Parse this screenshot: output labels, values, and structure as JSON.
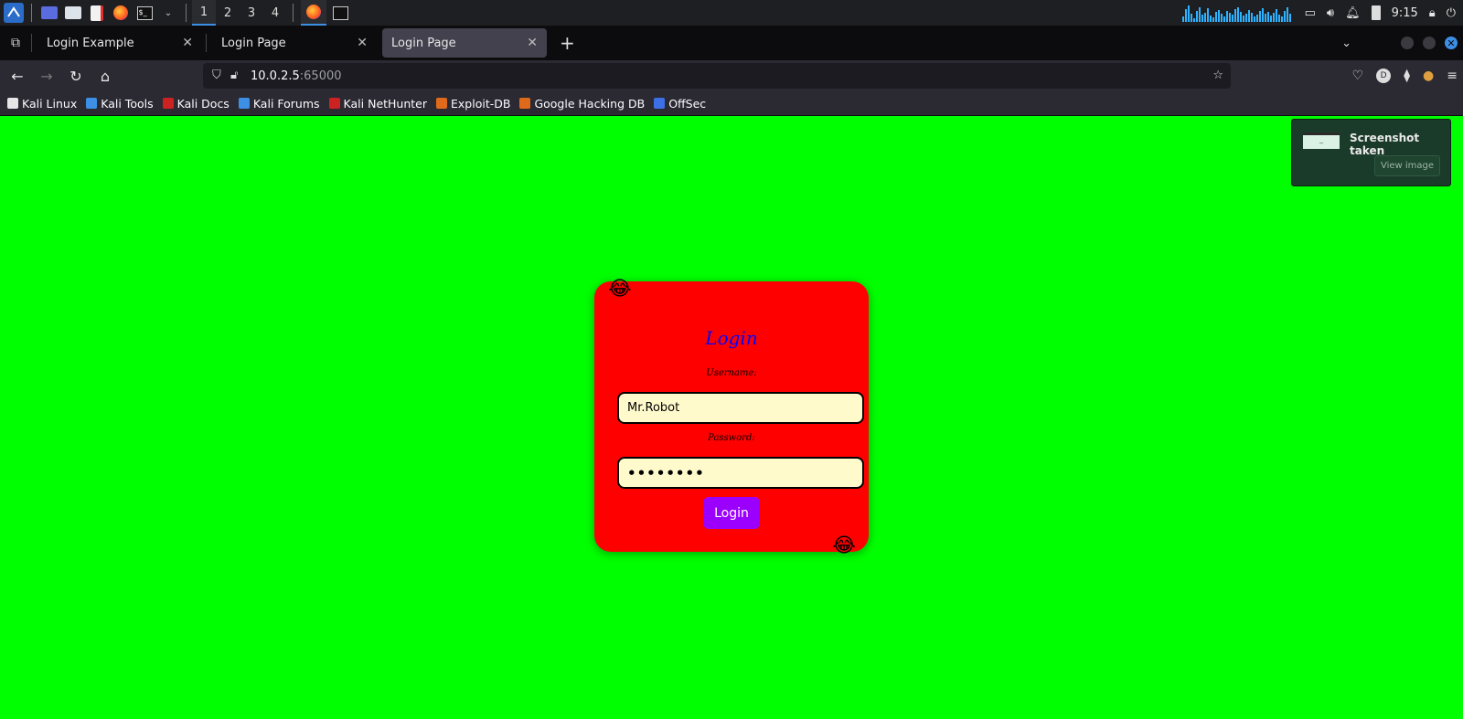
{
  "taskbar": {
    "workspaces": [
      "1",
      "2",
      "3",
      "4"
    ],
    "active_workspace": "1",
    "clock": "9:15"
  },
  "tabs": [
    {
      "label": "Login Example",
      "active": false
    },
    {
      "label": "Login Page",
      "active": false
    },
    {
      "label": "Login Page",
      "active": true
    }
  ],
  "url": {
    "host": "10.0.2.5",
    "port": ":65000"
  },
  "bookmarks": [
    {
      "label": "Kali Linux",
      "icon": "kali-icon",
      "color": "#e6e6e6"
    },
    {
      "label": "Kali Tools",
      "icon": "kali-tools-icon",
      "color": "#3d8fe6"
    },
    {
      "label": "Kali Docs",
      "icon": "kali-docs-icon",
      "color": "#cc2222"
    },
    {
      "label": "Kali Forums",
      "icon": "kali-forums-icon",
      "color": "#3d8fe6"
    },
    {
      "label": "Kali NetHunter",
      "icon": "nethunter-icon",
      "color": "#cc2222"
    },
    {
      "label": "Exploit-DB",
      "icon": "exploit-db-icon",
      "color": "#e06a1b"
    },
    {
      "label": "Google Hacking DB",
      "icon": "ghdb-icon",
      "color": "#e06a1b"
    },
    {
      "label": "OffSec",
      "icon": "offsec-icon",
      "color": "#3d6fe6"
    }
  ],
  "login": {
    "title": "Login",
    "username_label": "Username:",
    "username_value": "Mr.Robot",
    "password_label": "Password:",
    "password_value": "••••••••",
    "button_label": "Login",
    "emoji": "😂"
  },
  "notification": {
    "title": "Screenshot taken",
    "button": "View image"
  },
  "colors": {
    "page_bg": "#00ff00",
    "card_bg": "#ff0000",
    "title": "#0000ff",
    "input_bg": "#fffacc",
    "button_bg": "#9b00ff"
  }
}
